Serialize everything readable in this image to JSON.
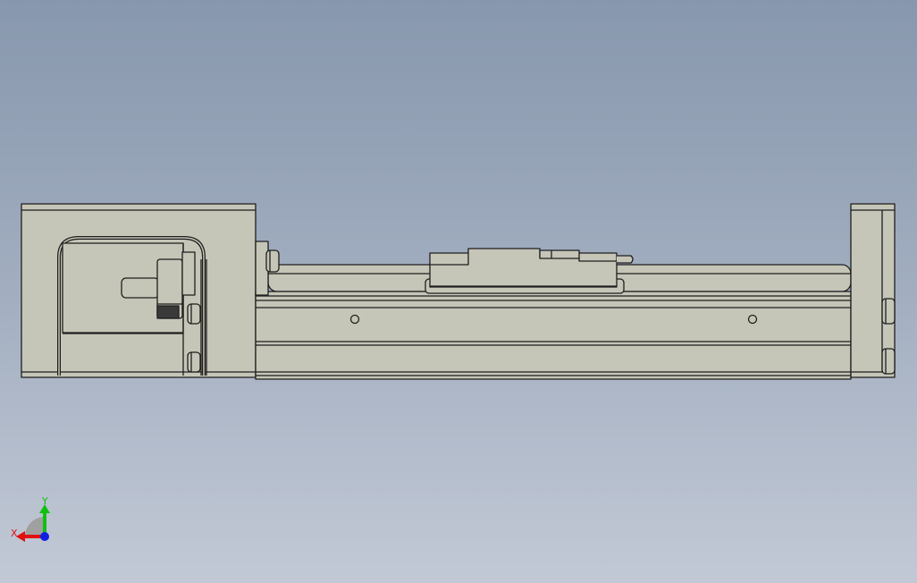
{
  "viewport": {
    "background_top": "#8797ad",
    "background_bottom": "#c2c9d6"
  },
  "model": {
    "body_color": "#c6c6b8",
    "edge_color": "#1e1e1e"
  },
  "triad": {
    "x_label": "X",
    "y_label": "Y",
    "x_color": "#e01010",
    "y_color": "#10c010",
    "z_color": "#1020e0"
  }
}
